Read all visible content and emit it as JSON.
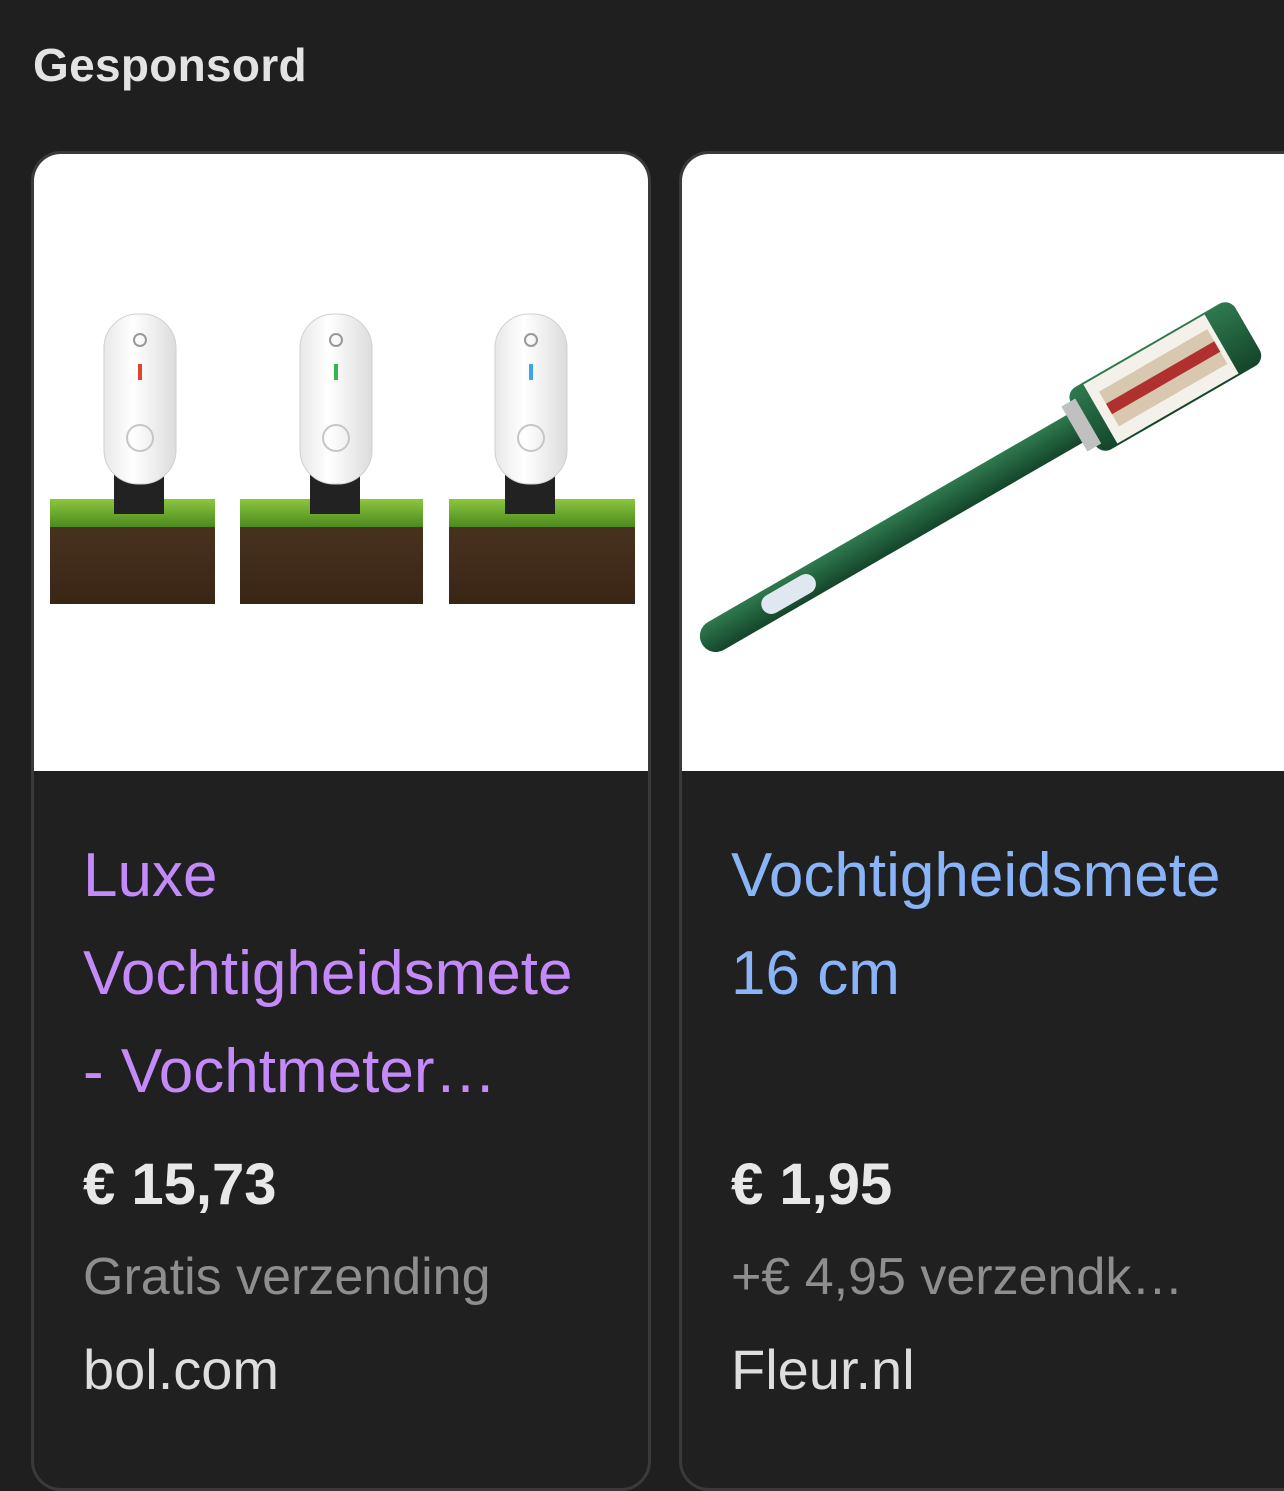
{
  "header": {
    "label": "Gesponsord"
  },
  "products": [
    {
      "title": "Luxe\nVochtigheidsmete\n- Vochtmeter…",
      "price": "€ 15,73",
      "shipping": "Gratis verzending",
      "seller": "bol.com",
      "title_color": "#c58af9",
      "image_icon": "soil-moisture-sensor-image"
    },
    {
      "title": "Vochtigheidsmete\n16 cm",
      "price": "€ 1,95",
      "shipping": "+€ 4,95 verzendk…",
      "seller": "Fleur.nl",
      "title_color": "#8ab4f8",
      "image_icon": "moisture-meter-probe-image"
    }
  ]
}
